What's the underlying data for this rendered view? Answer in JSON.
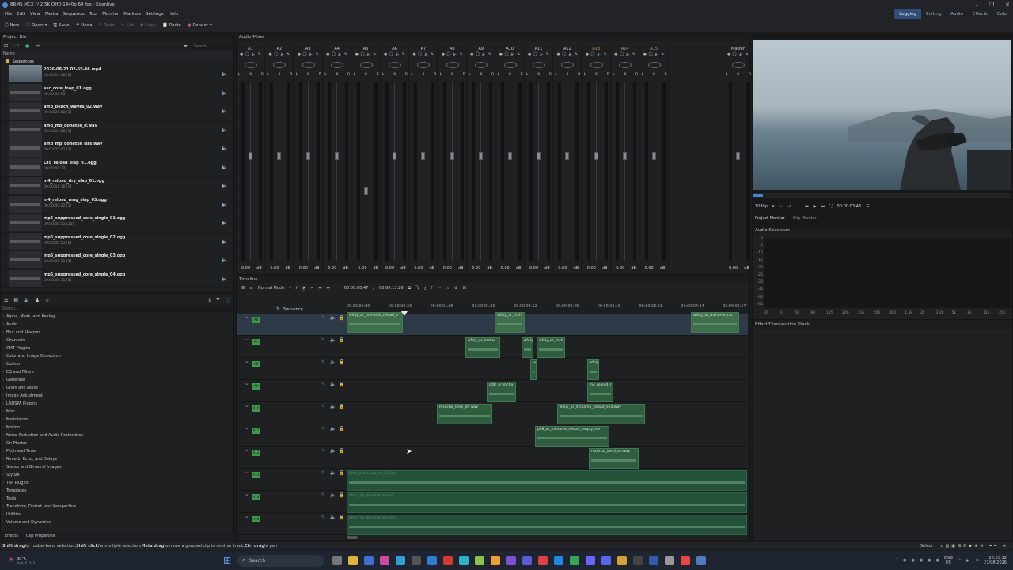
{
  "window": {
    "title": "8RMS MCX */ 2.5K QHD 1440p 60 fps - Kdenlive"
  },
  "menu": [
    "File",
    "Edit",
    "View",
    "Media",
    "Sequence",
    "Tool",
    "Monitor",
    "Markers",
    "Settings",
    "Help"
  ],
  "toolbar": {
    "new": "New",
    "open": "Open",
    "save": "Save",
    "undo": "Undo",
    "redo": "Redo",
    "cut": "Cut",
    "copy": "Copy",
    "paste": "Paste",
    "render": "Render"
  },
  "workspaces": [
    "Logging",
    "Editing",
    "Audio",
    "Effects",
    "Color"
  ],
  "project_bin": {
    "title": "Project Bin",
    "search_placeholder": "Search...",
    "column": "Name",
    "folder": "Sequences",
    "items": [
      {
        "name": "2026-08-21 02-55-46.mp4",
        "duration": "00:00:14:40 [2]",
        "type": "video"
      },
      {
        "name": "asc_core_loop_01.ogg",
        "duration": "00:00:00:05",
        "type": "audio"
      },
      {
        "name": "amb_beach_waves_02.wav",
        "duration": "00:00:20:00 [1]",
        "type": "audio"
      },
      {
        "name": "amb_mp_donetsk_lr.wav",
        "duration": "00:03:24:58 [1]",
        "type": "audio"
      },
      {
        "name": "amb_mp_donetsk_lsrs.wav",
        "duration": "00:03:25:02 [1]",
        "type": "audio"
      },
      {
        "name": "L85_reload_slap_01.ogg",
        "duration": "00:00:00:27",
        "type": "audio"
      },
      {
        "name": "m4_reload_dry_slap_01.ogg",
        "duration": "00:00:01:10 [1]",
        "type": "audio"
      },
      {
        "name": "m4_reload_mag_slap_03.ogg",
        "duration": "00:00:00:22 [1]",
        "type": "audio"
      },
      {
        "name": "mp5_suppressed_core_single_01.ogg",
        "duration": "00:00:00:51 [10]",
        "type": "audio"
      },
      {
        "name": "mp5_suppressed_core_single_02.ogg",
        "duration": "00:00:00:51 [6]",
        "type": "audio"
      },
      {
        "name": "mp5_suppressed_core_single_03.ogg",
        "duration": "00:00:00:51 [9]",
        "type": "audio"
      },
      {
        "name": "mp5_suppressed_core_single_04.ogg",
        "duration": "00:00:00:51 [3]",
        "type": "audio"
      }
    ]
  },
  "effects": {
    "search_placeholder": "Search...",
    "items": [
      "Alpha, Mask, and Keying",
      "Audio",
      "Blur and Sharpen",
      "Channels",
      "CMT Plugins",
      "Color and Image Correction",
      "Custom",
      "EQ and Filters",
      "Generate",
      "Grain and Noise",
      "Image Adjustment",
      "LADSPA Plugins",
      "Misc",
      "Modulators",
      "Motion",
      "Noise Reduction and Audio Restoration",
      "On Master",
      "Pitch and Time",
      "Reverb, Echo, and Delays",
      "Stereo and Binaural Images",
      "Stylize",
      "TAP Plugins",
      "Templates",
      "Tools",
      "Transform, Distort, and Perspective",
      "Utilities",
      "Volume and Dynamics"
    ],
    "tabs": [
      "Effects",
      "Clip Properties"
    ]
  },
  "mixer": {
    "title": "Audio Mixer",
    "channels": [
      {
        "label": "A1",
        "vol": "0.00",
        "unit": "dB"
      },
      {
        "label": "A2",
        "vol": "0.00",
        "unit": "dB"
      },
      {
        "label": "A3",
        "vol": "0.00",
        "unit": "dB"
      },
      {
        "label": "A4",
        "vol": "0.00",
        "unit": "dB"
      },
      {
        "label": "A5",
        "vol": "-6.00",
        "unit": "dB"
      },
      {
        "label": "A6",
        "vol": "0.00",
        "unit": "dB"
      },
      {
        "label": "A7",
        "vol": "0.00",
        "unit": "dB"
      },
      {
        "label": "A8",
        "vol": "0.00",
        "unit": "dB"
      },
      {
        "label": "A9",
        "vol": "0.00",
        "unit": "dB"
      },
      {
        "label": "A10",
        "vol": "0.00",
        "unit": "dB"
      },
      {
        "label": "A11",
        "vol": "0.00",
        "unit": "dB"
      },
      {
        "label": "A12",
        "vol": "0.00",
        "unit": "dB"
      },
      {
        "label": "A13",
        "vol": "0.00",
        "unit": "dB"
      },
      {
        "label": "A14",
        "vol": "0.00",
        "unit": "dB"
      },
      {
        "label": "A15",
        "vol": "0.00",
        "unit": "dB"
      }
    ],
    "master": {
      "label": "Master",
      "vol": "0.00",
      "unit": "dB"
    },
    "lr": [
      "L",
      "0",
      "R"
    ]
  },
  "monitor": {
    "resolution": "1080p",
    "timecode": "00:00:03:43",
    "tabs": [
      "Project Monitor",
      "Clip Monitor"
    ]
  },
  "spectrum": {
    "title": "Audio Spectrum",
    "y_ticks": [
      "0",
      "-5",
      "-10",
      "-15",
      "-20",
      "-25",
      "-30",
      "-35",
      "-40",
      "-45"
    ],
    "x_ticks": [
      "20",
      "31",
      "50",
      "80",
      "125",
      "200",
      "315",
      "500",
      "800",
      "1.3k",
      "2k",
      "3.2k",
      "5k",
      "8k",
      "12k",
      "20k"
    ]
  },
  "effect_stack": {
    "title": "Effect/Composition Stack"
  },
  "timeline": {
    "title": "Timeline",
    "mode": "Normal Mode",
    "position": "00:00:00:47",
    "duration": "00:00:13:26",
    "sequence_label": "Sequence",
    "ruler": [
      "00:00:00:00",
      "00:00:00:33",
      "00:00:01:06",
      "00:00:01:39",
      "00:00:02:12",
      "00:00:02:45",
      "00:00:03:18",
      "00:00:03:51",
      "00:00:04:24",
      "00:00:04:57"
    ],
    "tracks": [
      "A6",
      "A7",
      "A8",
      "A9",
      "A10",
      "A11",
      "A12",
      "A13",
      "A14",
      "A15"
    ],
    "clips": [
      {
        "track": 0,
        "label": "wfoly_ar_mcharlie_reload_e",
        "start": 0.0,
        "len": 0.14
      },
      {
        "track": 0,
        "label": "wfoly_ar_mch",
        "start": 0.37,
        "len": 0.075
      },
      {
        "track": 0,
        "label": "wfoly_ar_mcharlie_rac",
        "start": 0.86,
        "len": 0.12
      },
      {
        "track": 1,
        "label": "wfoly_ar_mchar",
        "start": 0.296,
        "len": 0.088
      },
      {
        "track": 1,
        "label": "wfoly",
        "start": 0.436,
        "len": 0.03
      },
      {
        "track": 1,
        "label": "wfoly_ar_mch",
        "start": 0.474,
        "len": 0.072
      },
      {
        "track": 2,
        "label": "wf",
        "start": 0.459,
        "len": 0.015
      },
      {
        "track": 2,
        "label": "wfoly",
        "start": 0.6,
        "len": 0.03
      },
      {
        "track": 3,
        "label": "p08_ar_mcha",
        "start": 0.35,
        "len": 0.073
      },
      {
        "track": 3,
        "label": "m4_reload_r",
        "start": 0.6,
        "len": 0.067
      },
      {
        "track": 4,
        "label": "msecho_semi_off.wav",
        "start": 0.225,
        "len": 0.138
      },
      {
        "track": 4,
        "label": "wfoly_ar_mcharlie_reload_end.wav",
        "start": 0.525,
        "len": 0.221
      },
      {
        "track": 5,
        "label": "p08_ar_mcharlie_reload_empty_sm",
        "start": 0.47,
        "len": 0.186
      },
      {
        "track": 6,
        "label": "msecho_semi_on.wav",
        "start": 0.605,
        "len": 0.124
      },
      {
        "track": 7,
        "label": "amb_beach_waves_02.wav",
        "start": 0.0,
        "len": 1.0
      },
      {
        "track": 8,
        "label": "amb_mp_donetsk_lr.wav",
        "start": 0.0,
        "len": 1.0
      },
      {
        "track": 9,
        "label": "amb_mp_donetsk_lsrs.wav",
        "start": 0.0,
        "len": 1.0
      }
    ]
  },
  "status": {
    "hint_bold1": "Shift drag",
    "hint1": " for rubber-band selection, ",
    "hint_bold2": "Shift click",
    "hint2": " for multiple selection, ",
    "hint_bold3": "Meta drag",
    "hint3": " to move a grouped clip to another track, ",
    "hint_bold4": "Ctrl drag",
    "hint4": " to pan",
    "select": "Select"
  },
  "taskbar": {
    "weather_temp": "30°C",
    "weather_desc": "Pe'A 'F: 3x3",
    "search": "Search",
    "lang1": "ENG",
    "lang2": "US",
    "time": "20:53:12",
    "date": "21/08/2026"
  },
  "colors": {
    "accent": "#2f4f7a",
    "clip": "#2f5e3f",
    "track_tag": "#3d9a4a",
    "orange": "#d89a3a"
  }
}
